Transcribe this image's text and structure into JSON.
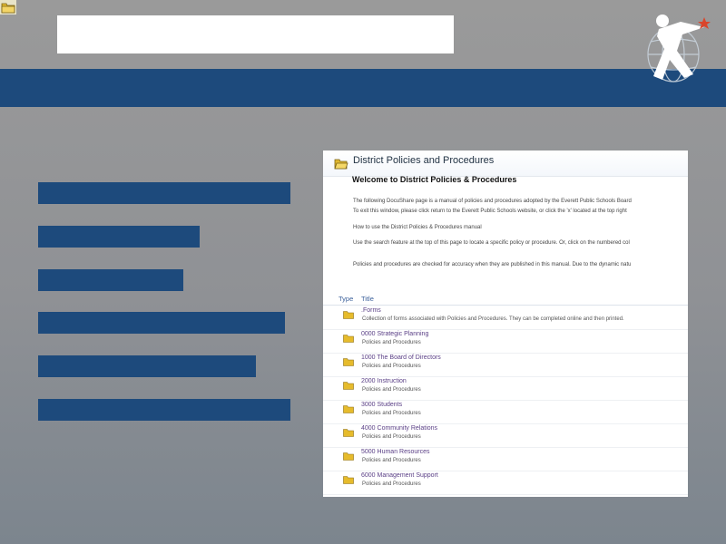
{
  "screenshot": {
    "header_title": "District Policies and Procedures",
    "welcome_title": "Welcome to District Policies & Procedures",
    "paragraphs": [
      "The following DocuShare page is a manual of policies and procedures adopted by the Everett Public Schools Board",
      "To exit this window, please click return to the Everett Public Schools website, or click the 'x' located at the top right",
      "How to use the District Policies & Procedures manual",
      "Use the search feature at the top of this page to locate a specific policy or procedure. Or, click on the numbered col",
      "Policies and procedures are checked for accuracy when they are published in this manual. Due to the dynamic natu"
    ],
    "columns": {
      "type": "Type",
      "title": "Title"
    },
    "rows": [
      {
        "title": ".Forms",
        "desc": "Collection of forms associated with Policies and Procedures. They can be completed online and then printed."
      },
      {
        "title": "0000 Strategic Planning",
        "desc": "Policies and Procedures"
      },
      {
        "title": "1000 The Board of Directors",
        "desc": "Policies and Procedures"
      },
      {
        "title": "2000 Instruction",
        "desc": "Policies and Procedures"
      },
      {
        "title": "3000 Students",
        "desc": "Policies and Procedures"
      },
      {
        "title": "4000 Community Relations",
        "desc": "Policies and Procedures"
      },
      {
        "title": "5000 Human Resources",
        "desc": "Policies and Procedures"
      },
      {
        "title": "6000 Management Support",
        "desc": "Policies and Procedures"
      }
    ]
  },
  "colors": {
    "band": "#1d4a7c",
    "bar": "#1d4a7c",
    "link": "#5a3f86",
    "logo_star": "#d9452b"
  },
  "icons": [
    "folder-icon",
    "district-logo"
  ]
}
